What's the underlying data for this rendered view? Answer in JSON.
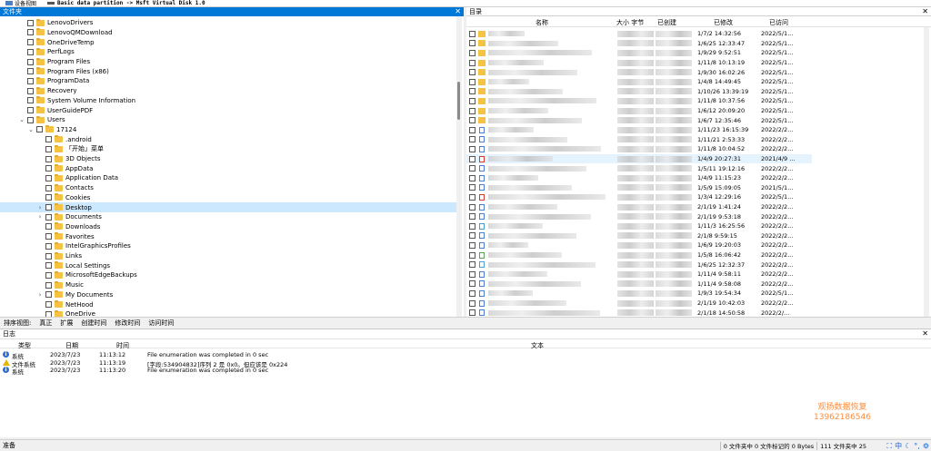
{
  "topbar": {
    "device_view": "设备视图",
    "tab_label": "Basic data partition -> Msft Virtual Disk 1.0"
  },
  "folder_pane": {
    "title": "文件夹"
  },
  "dir_pane": {
    "title": "目录"
  },
  "tree": [
    {
      "label": "LenovoDrivers",
      "indent": 0,
      "expander": ""
    },
    {
      "label": "LenovoQMDownload",
      "indent": 0,
      "expander": ""
    },
    {
      "label": "OneDriveTemp",
      "indent": 0,
      "expander": ""
    },
    {
      "label": "PerfLogs",
      "indent": 0,
      "expander": ""
    },
    {
      "label": "Program Files",
      "indent": 0,
      "expander": ""
    },
    {
      "label": "Program Files (x86)",
      "indent": 0,
      "expander": ""
    },
    {
      "label": "ProgramData",
      "indent": 0,
      "expander": ""
    },
    {
      "label": "Recovery",
      "indent": 0,
      "expander": ""
    },
    {
      "label": "System Volume Information",
      "indent": 0,
      "expander": ""
    },
    {
      "label": "UserGuidePDF",
      "indent": 0,
      "expander": ""
    },
    {
      "label": "Users",
      "indent": 0,
      "expander": "v"
    },
    {
      "label": "17124",
      "indent": 1,
      "expander": "v"
    },
    {
      "label": ".android",
      "indent": 2,
      "expander": ""
    },
    {
      "label": "「开始」菜单",
      "indent": 2,
      "expander": ""
    },
    {
      "label": "3D Objects",
      "indent": 2,
      "expander": ""
    },
    {
      "label": "AppData",
      "indent": 2,
      "expander": ""
    },
    {
      "label": "Application Data",
      "indent": 2,
      "expander": ""
    },
    {
      "label": "Contacts",
      "indent": 2,
      "expander": ""
    },
    {
      "label": "Cookies",
      "indent": 2,
      "expander": ""
    },
    {
      "label": "Desktop",
      "indent": 2,
      "expander": ">",
      "selected": true
    },
    {
      "label": "Documents",
      "indent": 2,
      "expander": ">"
    },
    {
      "label": "Downloads",
      "indent": 2,
      "expander": ""
    },
    {
      "label": "Favorites",
      "indent": 2,
      "expander": ""
    },
    {
      "label": "IntelGraphicsProfiles",
      "indent": 2,
      "expander": ""
    },
    {
      "label": "Links",
      "indent": 2,
      "expander": ""
    },
    {
      "label": "Local Settings",
      "indent": 2,
      "expander": ""
    },
    {
      "label": "MicrosoftEdgeBackups",
      "indent": 2,
      "expander": ""
    },
    {
      "label": "Music",
      "indent": 2,
      "expander": ""
    },
    {
      "label": "My Documents",
      "indent": 2,
      "expander": ">"
    },
    {
      "label": "NetHood",
      "indent": 2,
      "expander": ""
    },
    {
      "label": "OneDrive",
      "indent": 2,
      "expander": ""
    }
  ],
  "list": {
    "headers": {
      "name": "名称",
      "size": "大小 字节",
      "created": "已创建",
      "modified": "已修改",
      "accessed": "已访问"
    },
    "rows": [
      {
        "modified": "1/7/2 14:32:56",
        "accessed": "2022/5/1...",
        "icon": "folder"
      },
      {
        "modified": "1/6/25 12:33:47",
        "accessed": "2022/5/1...",
        "icon": "folder"
      },
      {
        "modified": "1/9/29 9:52:51",
        "accessed": "2022/5/1...",
        "icon": "folder"
      },
      {
        "modified": "1/11/8 10:13:19",
        "accessed": "2022/5/1...",
        "icon": "folder"
      },
      {
        "modified": "1/9/30 16:02:26",
        "accessed": "2022/5/1...",
        "icon": "folder"
      },
      {
        "modified": "1/4/8 14:49:45",
        "accessed": "2022/5/1...",
        "icon": "folder"
      },
      {
        "modified": "1/10/26 13:39:19",
        "accessed": "2022/5/1...",
        "icon": "folder"
      },
      {
        "modified": "1/11/8 10:37:56",
        "accessed": "2022/5/1...",
        "icon": "folder"
      },
      {
        "modified": "1/6/12 20:09:20",
        "accessed": "2022/5/1...",
        "icon": "folder"
      },
      {
        "modified": "1/6/7 12:35:46",
        "accessed": "2022/5/1...",
        "icon": "folder"
      },
      {
        "modified": "1/11/23 16:15:39",
        "accessed": "2022/2/2...",
        "icon": "doc"
      },
      {
        "modified": "1/11/21 2:53:33",
        "accessed": "2022/2/2...",
        "icon": "doc"
      },
      {
        "modified": "1/11/8 10:04:52",
        "accessed": "2022/2/2...",
        "icon": "doc"
      },
      {
        "modified": "1/4/9 20:27:31",
        "accessed": "2021/4/9 ...",
        "icon": "pdf",
        "sel": true
      },
      {
        "modified": "1/5/11 19:12:16",
        "accessed": "2022/2/2...",
        "icon": "doc"
      },
      {
        "modified": "1/4/9 11:15:23",
        "accessed": "2022/2/2...",
        "icon": "doc"
      },
      {
        "modified": "1/5/9 15:09:05",
        "accessed": "2021/5/1...",
        "icon": "doc"
      },
      {
        "modified": "1/3/4 12:29:16",
        "accessed": "2022/5/1...",
        "icon": "pdf"
      },
      {
        "modified": "2/1/19 1:41:24",
        "accessed": "2022/2/2...",
        "icon": "doc"
      },
      {
        "modified": "2/1/19 9:53:18",
        "accessed": "2022/2/2...",
        "icon": "doc"
      },
      {
        "modified": "1/11/3 16:25:56",
        "accessed": "2022/2/2...",
        "icon": "app"
      },
      {
        "modified": "2/1/8 9:59:15",
        "accessed": "2022/2/2...",
        "icon": "doc"
      },
      {
        "modified": "1/6/9 19:20:03",
        "accessed": "2022/2/2...",
        "icon": "doc"
      },
      {
        "modified": "1/5/8 16:06:42",
        "accessed": "2022/2/2...",
        "icon": "img"
      },
      {
        "modified": "1/6/25 12:32:37",
        "accessed": "2022/2/2...",
        "icon": "app"
      },
      {
        "modified": "1/11/4 9:58:11",
        "accessed": "2022/2/2...",
        "icon": "doc"
      },
      {
        "modified": "1/11/4 9:58:08",
        "accessed": "2022/2/2...",
        "icon": "doc"
      },
      {
        "modified": "1/9/3 19:54:34",
        "accessed": "2022/5/1...",
        "icon": "doc"
      },
      {
        "modified": "2/1/19 10:42:03",
        "accessed": "2022/2/2...",
        "icon": "doc"
      },
      {
        "modified": "2/1/18 14:50:58",
        "accessed": "2022/2/...",
        "icon": "doc"
      }
    ]
  },
  "sortbar": [
    "排序视图:",
    "真正",
    "扩展",
    "创建时间",
    "修改时间",
    "访问时间"
  ],
  "log": {
    "title": "日志",
    "columns": {
      "type": "类型",
      "date": "日期",
      "time": "时间",
      "text": "文本"
    },
    "rows": [
      {
        "icon": "info",
        "type": "系统",
        "date": "2023/7/23",
        "time": "11:13:12",
        "text": "File enumeration was completed in 0 sec"
      },
      {
        "icon": "warn",
        "type": "文件系统",
        "date": "2023/7/23",
        "time": "11:13:19",
        "text": "[字段:534904832]序列 2 是 0x0。但应该是 0x224"
      },
      {
        "icon": "info",
        "type": "系统",
        "date": "2023/7/23",
        "time": "11:13:20",
        "text": "File enumeration was completed in 0 sec"
      }
    ]
  },
  "watermark": {
    "line1": "观扬数据恢复",
    "line2": "13962186546"
  },
  "statusbar": {
    "left": "准备",
    "sel_info": "0 文件夹中 0 文件标记的 0 Bytes",
    "count": "111 文件夹中 25",
    "tray_ime": "中"
  },
  "colors": {
    "accent": "#0078d7",
    "selection": "#cce8ff",
    "folder": "#f5c243",
    "watermark": "#ff8c3a"
  }
}
